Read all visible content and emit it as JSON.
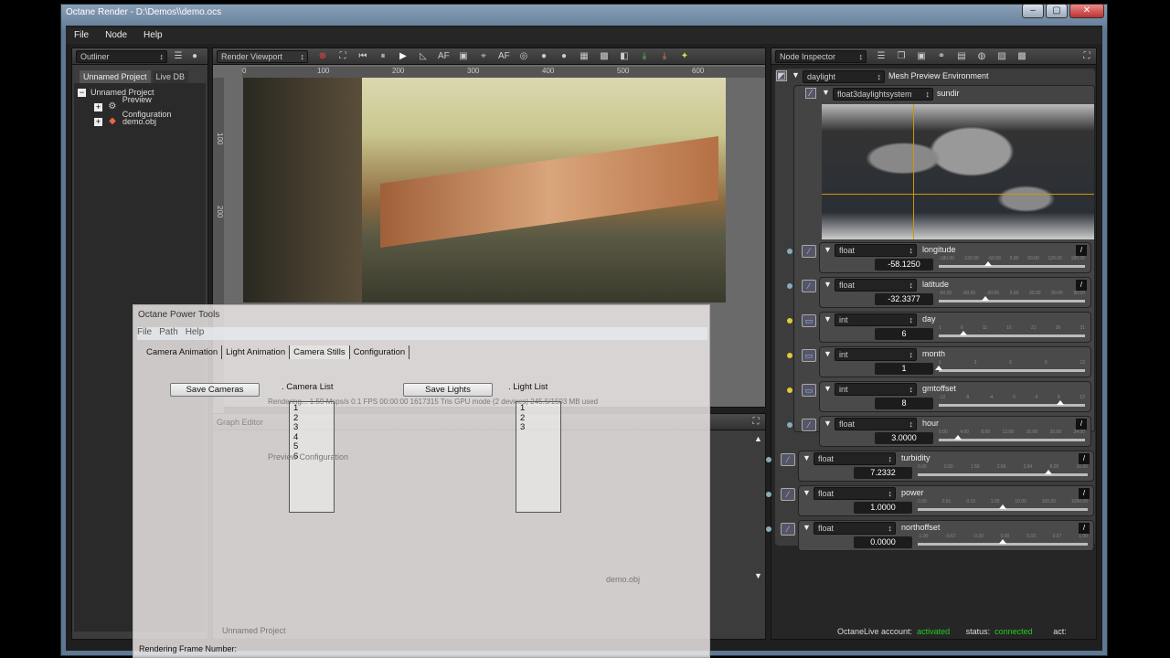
{
  "window": {
    "title": "Octane Render - D:\\Demos\\\\demo.ocs",
    "controls": [
      "–",
      "▢",
      "✕"
    ]
  },
  "menu": [
    "File",
    "Node",
    "Help"
  ],
  "outliner": {
    "title": "Outliner",
    "tabs": [
      "Unnamed Project",
      "Live DB"
    ],
    "tree": [
      {
        "label": "Unnamed Project",
        "level": 0,
        "toggle": "−"
      },
      {
        "label": "Preview Configuration",
        "level": 1,
        "toggle": "+"
      },
      {
        "label": "demo.obj",
        "level": 1,
        "toggle": "+"
      }
    ]
  },
  "viewport": {
    "title": "Render Viewport",
    "ruler_h": [
      "0",
      "100",
      "200",
      "300",
      "400",
      "500",
      "600"
    ],
    "ruler_v": [
      "100",
      "200"
    ],
    "status": "Rendering... 1.59 Msps/s  0.1 FPS  00:00:00   1617315 Tris  GPU mode (2 devices)  245.5/1503 MB used"
  },
  "graph": {
    "title": "Graph Editor",
    "node_label": "Preview Configuration",
    "bottom_label": "demo.obj",
    "project": "Unnamed Project"
  },
  "inspector": {
    "title": "Node Inspector",
    "root": {
      "type": "daylight",
      "name": "Mesh Preview Environment"
    },
    "sundir": {
      "type": "float3daylightsystem",
      "name": "sundir"
    },
    "params": [
      {
        "type": "float",
        "name": "longitude",
        "value": "-58.1250",
        "ticks": [
          "-180.00",
          "-120.00",
          "-60.00",
          "0.00",
          "60.00",
          "120.00",
          "180.00"
        ],
        "pos": 0.34,
        "dot": "#8ab"
      },
      {
        "type": "float",
        "name": "latitude",
        "value": "-32.3377",
        "ticks": [
          "-90.00",
          "-60.00",
          "-30.00",
          "0.00",
          "30.00",
          "60.00",
          "90.00"
        ],
        "pos": 0.32,
        "dot": "#8ab"
      },
      {
        "type": "int",
        "name": "day",
        "value": "6",
        "ticks": [
          "1",
          "6",
          "11",
          "16",
          "21",
          "26",
          "31"
        ],
        "pos": 0.17,
        "dot": "#dc3"
      },
      {
        "type": "int",
        "name": "month",
        "value": "1",
        "ticks": [
          "1",
          "3",
          "6",
          "9",
          "12"
        ],
        "pos": 0.0,
        "dot": "#dc3"
      },
      {
        "type": "int",
        "name": "gmtoffset",
        "value": "8",
        "ticks": [
          "-12",
          "-8",
          "-4",
          "0",
          "4",
          "8",
          "12"
        ],
        "pos": 0.83,
        "dot": "#dc3"
      },
      {
        "type": "float",
        "name": "hour",
        "value": "3.0000",
        "ticks": [
          "0.00",
          "4.00",
          "8.00",
          "12.00",
          "16.00",
          "20.00",
          "24.00"
        ],
        "pos": 0.13,
        "dot": "#8ab"
      },
      {
        "type": "float",
        "name": "turbidity",
        "value": "7.2332",
        "ticks": [
          "0.00",
          "0.50",
          "1.50",
          "2.65",
          "3.84",
          "8.00",
          "16.00"
        ],
        "pos": 0.77,
        "dot": "#8ab"
      },
      {
        "type": "float",
        "name": "power",
        "value": "1.0000",
        "ticks": [
          "0.00",
          "0.01",
          "0.10",
          "1.00",
          "10.00",
          "100.00",
          "1000.00"
        ],
        "pos": 0.5,
        "dot": "#8ab"
      },
      {
        "type": "float",
        "name": "northoffset",
        "value": "0.0000",
        "ticks": [
          "-1.00",
          "-0.67",
          "-0.33",
          "0.00",
          "0.33",
          "0.67",
          "1.00"
        ],
        "pos": 0.5,
        "dot": "#8ab"
      }
    ]
  },
  "status": {
    "account_label": "OctaneLive account:",
    "account_value": "activated",
    "status_label": "status:",
    "status_value": "connected",
    "act_label": "act:"
  },
  "dialog": {
    "title": "Octane Power Tools",
    "menu": [
      "File",
      "Path",
      "Help"
    ],
    "tabs": [
      "Camera Animation",
      "Light Animation",
      "Camera Stills",
      "Configuration"
    ],
    "active_tab": "Camera Stills",
    "save_cameras": "Save Cameras",
    "camera_list_label": ". Camera List",
    "cameras": [
      "1",
      "2",
      "3",
      "4",
      "5",
      "6"
    ],
    "save_lights": "Save Lights",
    "light_list_label": ". Light List",
    "lights": [
      "1",
      "2",
      "3"
    ],
    "footer": "Rendering Frame Number:"
  }
}
